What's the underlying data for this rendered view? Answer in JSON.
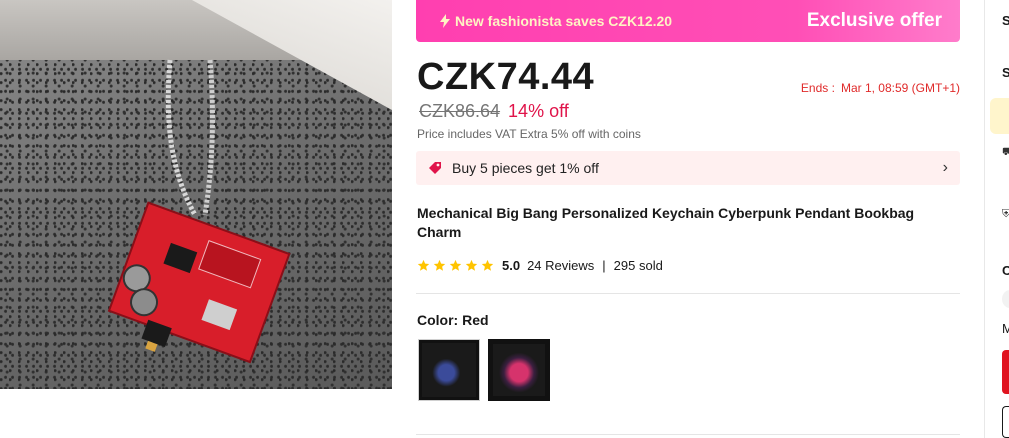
{
  "promo": {
    "left_text": "New fashionista saves CZK12.20",
    "right_text": "Exclusive offer",
    "icon": "lightning-icon"
  },
  "pricing": {
    "current_price": "CZK74.44",
    "original_price": "CZK86.64",
    "discount": "14% off",
    "ends_label": "Ends :",
    "ends_date": "Mar 1, 08:59 (GMT+1)",
    "vat_note": "Price includes VAT Extra 5% off with coins"
  },
  "bulk_offer": {
    "text": "Buy 5 pieces get 1% off",
    "icon": "price-tag-icon"
  },
  "product": {
    "title": "Mechanical Big Bang Personalized Keychain Cyberpunk Pendant Bookbag Charm",
    "rating": "5.0",
    "reviews": "24 Reviews",
    "sold": "295 sold",
    "star_count": 5,
    "star_color": "#ffc400"
  },
  "variants": {
    "label": "Color: Red",
    "selected_index": 1,
    "count": 2
  },
  "sidebar": {
    "fragment_1": "S",
    "fragment_2": "S",
    "fragment_3": "C",
    "fragment_4": "M"
  },
  "colors": {
    "accent": "#e0144a",
    "promo_bg": "#ff3fb0",
    "bulk_bg": "#fff0f0"
  }
}
